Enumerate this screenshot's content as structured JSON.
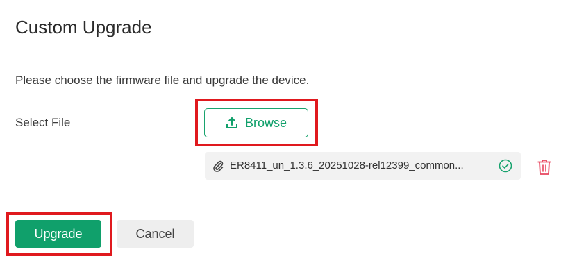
{
  "dialog": {
    "title": "Custom Upgrade",
    "description": "Please choose the firmware file and upgrade the device."
  },
  "file_select": {
    "label": "Select File",
    "browse_label": "Browse",
    "browse_icon": "upload-icon",
    "selected_file": {
      "name": "ER8411_un_1.3.6_20251028-rel12399_common...",
      "attachment_icon": "paperclip-icon",
      "status_icon": "check-circle-icon",
      "delete_icon": "trash-icon"
    }
  },
  "actions": {
    "upgrade_label": "Upgrade",
    "cancel_label": "Cancel"
  },
  "colors": {
    "primary_green": "#10a06b",
    "highlight_red": "#e0191e",
    "delete_red": "#e8465f",
    "file_row_bg": "#f2f2f2"
  }
}
